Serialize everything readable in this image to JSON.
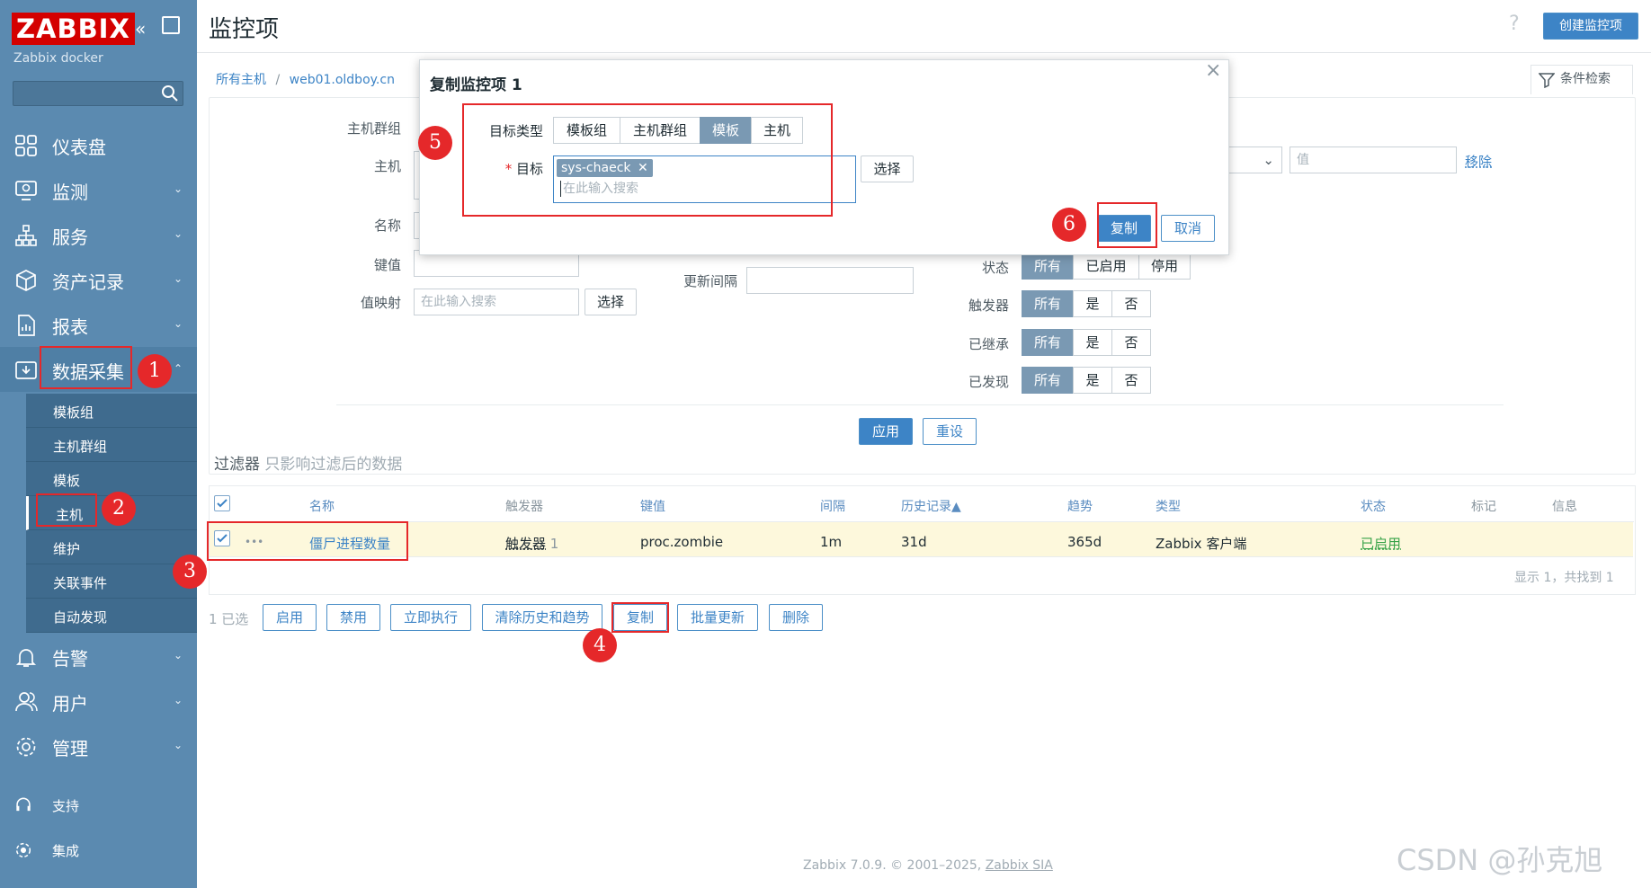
{
  "sidebar": {
    "logo": "ZABBIX",
    "server_name": "Zabbix docker",
    "menu": [
      {
        "label": "仪表盘"
      },
      {
        "label": "监测"
      },
      {
        "label": "服务"
      },
      {
        "label": "资产记录"
      },
      {
        "label": "报表"
      },
      {
        "label": "数据采集"
      },
      {
        "label": "告警"
      },
      {
        "label": "用户"
      },
      {
        "label": "管理"
      }
    ],
    "submenu": [
      "模板组",
      "主机群组",
      "模板",
      "主机",
      "维护",
      "关联事件",
      "自动发现"
    ],
    "bottom": [
      {
        "label": "支持"
      },
      {
        "label": "集成"
      }
    ]
  },
  "header": {
    "title": "监控项",
    "create_button": "创建监控项",
    "help": "?",
    "filter_tab": "条件检索"
  },
  "breadcrumb": {
    "all_hosts": "所有主机",
    "sep": "/",
    "host": "web01.oldboy.cn"
  },
  "filter": {
    "host_group_label": "主机群组",
    "host_label": "主机",
    "name_label": "名称",
    "key_label": "键值",
    "value_map_label": "值映射",
    "value_map_placeholder": "在此输入搜索",
    "select_button": "选择",
    "update_interval_label": "更新间隔",
    "value_placeholder": "值",
    "remove_link": "移除",
    "state_label": "状态",
    "state_options": [
      "所有",
      "已启用",
      "停用"
    ],
    "trigger_label": "触发器",
    "inherited_label": "已继承",
    "discovered_label": "已发现",
    "yes_no_options": [
      "所有",
      "是",
      "否"
    ],
    "apply_button": "应用",
    "reset_button": "重设",
    "subfilter_title": "过滤器",
    "subfilter_hint": "只影响过滤后的数据"
  },
  "table": {
    "headers": [
      "名称",
      "触发器",
      "键值",
      "间隔",
      "历史记录▲",
      "趋势",
      "类型",
      "状态",
      "标记",
      "信息"
    ],
    "rows": [
      {
        "menu": "•••",
        "name": "僵尸进程数量",
        "triggers": "触发器",
        "trigger_count": "1",
        "key": "proc.zombie",
        "interval": "1m",
        "history": "31d",
        "trends": "365d",
        "type": "Zabbix 客户端",
        "status": "已启用"
      }
    ],
    "footer": "显示 1，共找到 1"
  },
  "mass_actions": {
    "selected": "1 已选",
    "buttons": [
      "启用",
      "禁用",
      "立即执行",
      "清除历史和趋势",
      "复制",
      "批量更新",
      "删除"
    ]
  },
  "dialog": {
    "title": "复制监控项 1",
    "target_type_label": "目标类型",
    "target_types": [
      "模板组",
      "主机群组",
      "模板",
      "主机"
    ],
    "target_label": "目标",
    "required_mark": "*",
    "target_chip": "sys-chaeck",
    "target_placeholder": "在此输入搜索",
    "select_button": "选择",
    "copy_button": "复制",
    "cancel_button": "取消",
    "close": "×"
  },
  "footer": {
    "text": "Zabbix 7.0.9. © 2001–2025,",
    "link": "Zabbix SIA"
  },
  "watermark": "CSDN @孙克旭",
  "annotations": [
    "1",
    "2",
    "3",
    "4",
    "5",
    "6"
  ],
  "colors": {
    "sidebar": "#5b8ab0",
    "accent": "#3d84c6",
    "highlight_row": "#fdf8dc",
    "annotation": "#e5282a",
    "logo": "#d40000"
  }
}
